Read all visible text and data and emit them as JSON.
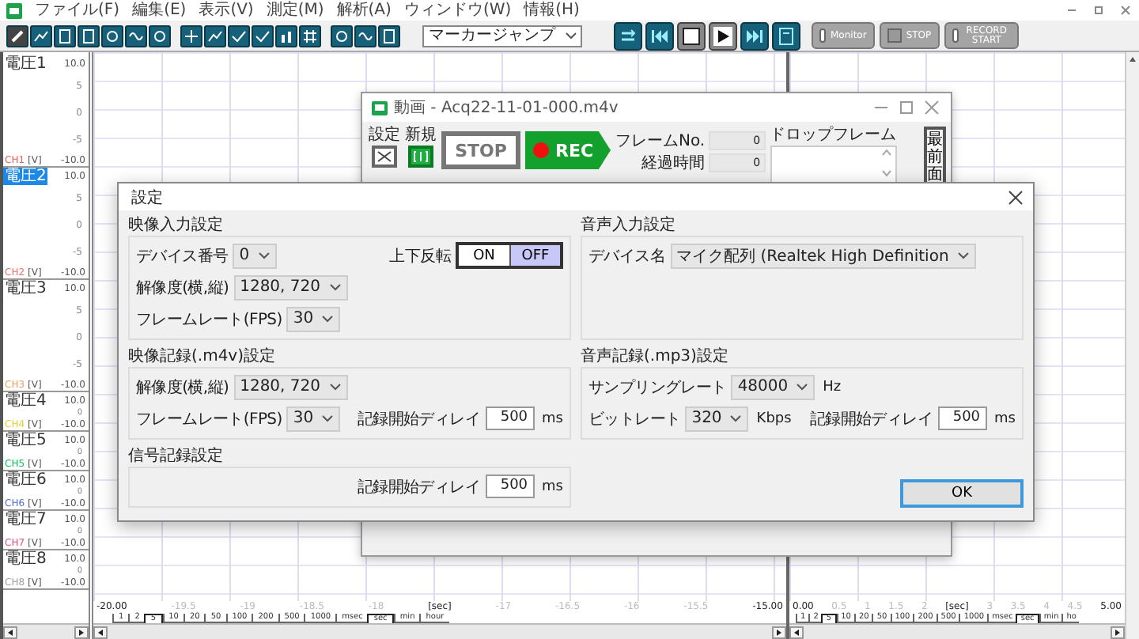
{
  "menu": [
    {
      "label": "ファイル(F)"
    },
    {
      "label": "編集(E)"
    },
    {
      "label": "表示(V)"
    },
    {
      "label": "測定(M)"
    },
    {
      "label": "解析(A)"
    },
    {
      "label": "ウィンドウ(W)"
    },
    {
      "label": "情報(H)"
    }
  ],
  "toolbar": {
    "marker_dropdown": {
      "value": "マーカージャンプ"
    },
    "record_buttons": [
      {
        "label": "Monitor",
        "kind": "lamp"
      },
      {
        "label": "STOP",
        "kind": "square"
      },
      {
        "label": "RECORD START",
        "kind": "lamp"
      }
    ]
  },
  "channels": [
    {
      "name": "電圧1",
      "max": "10.0",
      "ticks": [
        "5",
        "0",
        "-5"
      ],
      "channel": "CH1",
      "unit": "[V]",
      "min": "-10.0",
      "color": "#e06060",
      "selected": false
    },
    {
      "name": "電圧2",
      "max": "10.0",
      "ticks": [
        "5",
        "0",
        "-5"
      ],
      "channel": "CH2",
      "unit": "[V]",
      "min": "-10.0",
      "color": "#e87070",
      "selected": true
    },
    {
      "name": "電圧3",
      "max": "10.0",
      "ticks": [
        "5",
        "0",
        "-5"
      ],
      "channel": "CH3",
      "unit": "[V]",
      "min": "-10.0",
      "color": "#f0a060",
      "selected": false
    },
    {
      "name": "電圧4",
      "max": "10.0",
      "ticks": [
        "0"
      ],
      "channel": "CH4",
      "unit": "[V]",
      "min": "-10.0",
      "color": "#e0d030",
      "selected": false
    },
    {
      "name": "電圧5",
      "max": "10.0",
      "ticks": [
        "0"
      ],
      "channel": "CH5",
      "unit": "[V]",
      "min": "-10.0",
      "color": "#10c060",
      "selected": false
    },
    {
      "name": "電圧6",
      "max": "10.0",
      "ticks": [
        "0"
      ],
      "channel": "CH6",
      "unit": "[V]",
      "min": "-10.0",
      "color": "#5070d0",
      "selected": false
    },
    {
      "name": "電圧7",
      "max": "10.0",
      "ticks": [
        "0"
      ],
      "channel": "CH7",
      "unit": "[V]",
      "min": "-10.0",
      "color": "#e05080",
      "selected": false
    },
    {
      "name": "電圧8",
      "max": "10.0",
      "ticks": [
        "0"
      ],
      "channel": "CH8",
      "unit": "[V]",
      "min": "-10.0",
      "color": "#a0a0a0",
      "selected": false
    }
  ],
  "time_panes": [
    {
      "axis_labels": [
        {
          "text": "-20.00",
          "kind": "major"
        },
        {
          "text": "-19.5",
          "kind": "minor"
        },
        {
          "text": "-19",
          "kind": "minor"
        },
        {
          "text": "-18.5",
          "kind": "minor"
        },
        {
          "text": "-18",
          "kind": "minor"
        },
        {
          "text": "[sec]",
          "kind": "major"
        },
        {
          "text": "-17",
          "kind": "minor"
        },
        {
          "text": "-16.5",
          "kind": "minor"
        },
        {
          "text": "-16",
          "kind": "minor"
        },
        {
          "text": "-15.5",
          "kind": "minor"
        },
        {
          "text": "-15.00",
          "kind": "major"
        }
      ],
      "scales": [
        {
          "label": "1",
          "selected": false
        },
        {
          "label": "2",
          "selected": false
        },
        {
          "label": "5",
          "selected": true
        },
        {
          "label": "10",
          "selected": false
        },
        {
          "label": "20",
          "selected": false
        },
        {
          "label": "50",
          "selected": false
        },
        {
          "label": "100",
          "selected": false
        },
        {
          "label": "200",
          "selected": false
        },
        {
          "label": "500",
          "selected": false
        },
        {
          "label": "1000",
          "selected": false
        },
        {
          "label": "msec",
          "selected": false
        },
        {
          "label": "sec",
          "selected": true
        },
        {
          "label": "min",
          "selected": false
        },
        {
          "label": "hour",
          "selected": false
        }
      ]
    },
    {
      "axis_labels": [
        {
          "text": "0.00",
          "kind": "major"
        },
        {
          "text": "0.5",
          "kind": "minor"
        },
        {
          "text": "1",
          "kind": "minor"
        },
        {
          "text": "1.5",
          "kind": "minor"
        },
        {
          "text": "2",
          "kind": "minor"
        },
        {
          "text": "[sec]",
          "kind": "major"
        },
        {
          "text": "3",
          "kind": "minor"
        },
        {
          "text": "3.5",
          "kind": "minor"
        },
        {
          "text": "4",
          "kind": "minor"
        },
        {
          "text": "4.5",
          "kind": "minor"
        },
        {
          "text": "5.00",
          "kind": "major"
        }
      ],
      "scales": [
        {
          "label": "1",
          "selected": false
        },
        {
          "label": "2",
          "selected": false
        },
        {
          "label": "5",
          "selected": true
        },
        {
          "label": "10",
          "selected": false
        },
        {
          "label": "20",
          "selected": false
        },
        {
          "label": "50",
          "selected": false
        },
        {
          "label": "100",
          "selected": false
        },
        {
          "label": "200",
          "selected": false
        },
        {
          "label": "500",
          "selected": false
        },
        {
          "label": "1000",
          "selected": false
        },
        {
          "label": "msec",
          "selected": false
        },
        {
          "label": "sec",
          "selected": true
        },
        {
          "label": "min",
          "selected": false
        },
        {
          "label": "ho",
          "selected": false
        }
      ]
    }
  ],
  "video_window": {
    "title": "動画 - Acq22-11-01-000.m4v",
    "tools": [
      {
        "label": "設定",
        "kind": "settings"
      },
      {
        "label": "新規",
        "kind": "new"
      }
    ],
    "stop_label": "STOP",
    "rec_label": "REC",
    "readouts": [
      {
        "label": "フレームNo.",
        "value": "0"
      },
      {
        "label": "経過時間",
        "value": "0"
      }
    ],
    "drop_frame_label": "ドロップフレーム",
    "topmost_label": "最前面"
  },
  "settings_dialog": {
    "title": "設定",
    "columns": [
      {
        "groups": [
          {
            "title": "映像入力設定",
            "rows": [
              [
                {
                  "kind": "select",
                  "label": "デバイス番号",
                  "value": "0"
                },
                {
                  "kind": "toggle",
                  "label": "上下反転",
                  "options": [
                    {
                      "label": "ON",
                      "selected": false
                    },
                    {
                      "label": "OFF",
                      "selected": true
                    }
                  ]
                }
              ],
              [
                {
                  "kind": "select",
                  "label": "解像度(横,縦)",
                  "value": "1280, 720"
                }
              ],
              [
                {
                  "kind": "select",
                  "label": "フレームレート(FPS)",
                  "value": "30"
                }
              ]
            ]
          },
          {
            "title": "映像記録(.m4v)設定",
            "rows": [
              [
                {
                  "kind": "select",
                  "label": "解像度(横,縦)",
                  "value": "1280, 720"
                }
              ],
              [
                {
                  "kind": "select",
                  "label": "フレームレート(FPS)",
                  "value": "30"
                },
                {
                  "kind": "number",
                  "label": "記録開始ディレイ",
                  "value": "500",
                  "unit": "ms"
                }
              ]
            ]
          },
          {
            "title": "信号記録設定",
            "rows": [
              [
                {
                  "kind": "number",
                  "label": "記録開始ディレイ",
                  "value": "500",
                  "unit": "ms"
                }
              ]
            ]
          }
        ]
      },
      {
        "groups": [
          {
            "title": "音声入力設定",
            "rows": [
              [
                {
                  "kind": "select",
                  "label": "デバイス名",
                  "value": "マイク配列 (Realtek High Definition"
                }
              ]
            ]
          },
          {
            "title": "音声記録(.mp3)設定",
            "rows": [
              [
                {
                  "kind": "select",
                  "label": "サンプリングレート",
                  "value": "48000",
                  "unit": "Hz"
                }
              ],
              [
                {
                  "kind": "select",
                  "label": "ビットレート",
                  "value": "320",
                  "unit": "Kbps"
                },
                {
                  "kind": "number",
                  "label": "記録開始ディレイ",
                  "value": "500",
                  "unit": "ms"
                }
              ]
            ]
          }
        ]
      }
    ],
    "buttons": [
      {
        "label": "OK",
        "focused": true
      }
    ]
  }
}
